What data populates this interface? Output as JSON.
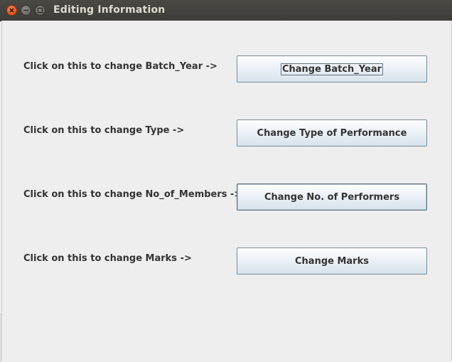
{
  "window": {
    "title": "Editing Information"
  },
  "rows": [
    {
      "label": "Click on this to change Batch_Year ->",
      "button": "Change Batch_Year"
    },
    {
      "label": "Click on this to change Type ->",
      "button": "Change Type of Performance"
    },
    {
      "label": "Click on this to change No_of_Members ->",
      "button": "Change No. of Performers"
    },
    {
      "label": "Click on this to change Marks ->",
      "button": "Change Marks"
    }
  ],
  "colors": {
    "titlebar": "#3d3c38",
    "close_button": "#e2541c",
    "panel_background": "#eeeeee"
  }
}
